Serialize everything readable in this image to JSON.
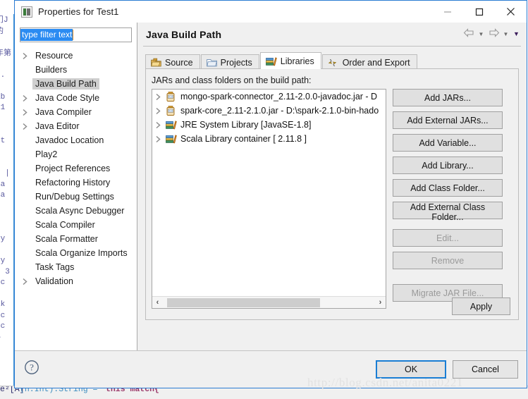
{
  "window": {
    "title": "Properties for Test1",
    "icon": "properties-icon",
    "controls": {
      "minimize": "—",
      "maximize": "□",
      "close": "✕"
    }
  },
  "filter": {
    "value": "type filter text",
    "placeholder": "type filter text"
  },
  "sidebar": {
    "items": [
      {
        "label": "Resource",
        "expandable": true,
        "selected": false
      },
      {
        "label": "Builders",
        "expandable": false,
        "selected": false
      },
      {
        "label": "Java Build Path",
        "expandable": false,
        "selected": true
      },
      {
        "label": "Java Code Style",
        "expandable": true,
        "selected": false
      },
      {
        "label": "Java Compiler",
        "expandable": true,
        "selected": false
      },
      {
        "label": "Java Editor",
        "expandable": true,
        "selected": false
      },
      {
        "label": "Javadoc Location",
        "expandable": false,
        "selected": false
      },
      {
        "label": "Play2",
        "expandable": false,
        "selected": false
      },
      {
        "label": "Project References",
        "expandable": false,
        "selected": false
      },
      {
        "label": "Refactoring History",
        "expandable": false,
        "selected": false
      },
      {
        "label": "Run/Debug Settings",
        "expandable": false,
        "selected": false
      },
      {
        "label": "Scala Async Debugger",
        "expandable": false,
        "selected": false
      },
      {
        "label": "Scala Compiler",
        "expandable": false,
        "selected": false
      },
      {
        "label": "Scala Formatter",
        "expandable": false,
        "selected": false
      },
      {
        "label": "Scala Organize Imports",
        "expandable": false,
        "selected": false
      },
      {
        "label": "Task Tags",
        "expandable": false,
        "selected": false
      },
      {
        "label": "Validation",
        "expandable": true,
        "selected": false
      }
    ]
  },
  "page": {
    "title": "Java Build Path",
    "nav": {
      "back": "back-arrow",
      "forward": "forward-arrow",
      "menu": "view-menu-caret"
    }
  },
  "tabs": [
    {
      "label": "Source",
      "icon": "source-folder-icon",
      "active": false
    },
    {
      "label": "Projects",
      "icon": "projects-folder-icon",
      "active": false
    },
    {
      "label": "Libraries",
      "icon": "libraries-books-icon",
      "active": true
    },
    {
      "label": "Order and Export",
      "icon": "order-export-icon",
      "active": false
    }
  ],
  "libraries": {
    "label": "JARs and class folders on the build path:",
    "entries": [
      {
        "icon": "jar-icon",
        "text": "mongo-spark-connector_2.11-2.0.0-javadoc.jar - D",
        "expandable": true
      },
      {
        "icon": "jar-icon",
        "text": "spark-core_2.11-2.1.0.jar - D:\\spark-2.1.0-bin-hado",
        "expandable": true
      },
      {
        "icon": "library-icon",
        "text": "JRE System Library [JavaSE-1.8]",
        "expandable": true
      },
      {
        "icon": "library-icon",
        "text": "Scala Library container [ 2.11.8 ]",
        "expandable": true
      }
    ],
    "scrollbar": {
      "left_arrow": "‹",
      "right_arrow": "›",
      "thumb_start_pct": 2,
      "thumb_width_pct": 72
    }
  },
  "side_buttons": [
    {
      "label": "Add JARs...",
      "enabled": true,
      "group": 1
    },
    {
      "label": "Add External JARs...",
      "enabled": true,
      "group": 1
    },
    {
      "label": "Add Variable...",
      "enabled": true,
      "group": 1
    },
    {
      "label": "Add Library...",
      "enabled": true,
      "group": 1
    },
    {
      "label": "Add Class Folder...",
      "enabled": true,
      "group": 1
    },
    {
      "label": "Add External Class Folder...",
      "enabled": true,
      "group": 1
    },
    {
      "label": "Edit...",
      "enabled": false,
      "group": 2
    },
    {
      "label": "Remove",
      "enabled": false,
      "group": 2
    },
    {
      "label": "Migrate JAR File...",
      "enabled": false,
      "group": 3
    }
  ],
  "apply": {
    "label": "Apply"
  },
  "footer": {
    "help_icon": "help-question-icon",
    "ok": "OK",
    "cancel": "Cancel"
  },
  "watermark": "http://blog.csdn.net/anita0221",
  "background": {
    "code_fragment": "门J\n的\nt\n年第\n\nn.\n\nab\n=1\ns\n\nst\n\n\ns |\n/a\n/a\n( \n\n\nty\n\nly\n- 3\n=c\n\nak\n=c\n=c\n—",
    "bottom_line": {
      "seg1": "e²[A]",
      "seg2": "(n:Int):String =",
      "seg3": "this match{"
    }
  },
  "colors": {
    "accent_blue": "#2b7cd3",
    "selection_blue": "#2a8bf2",
    "dialog_bg": "#f0f0f0",
    "tree_selected": "#cfcfcf"
  }
}
